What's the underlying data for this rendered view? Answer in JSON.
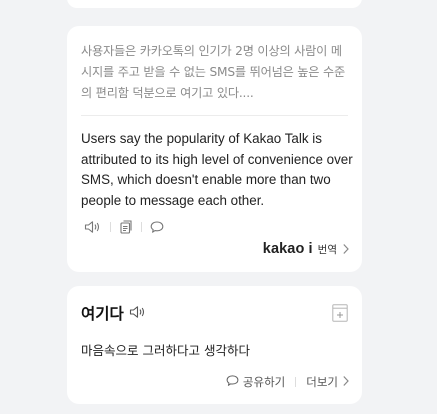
{
  "translation": {
    "source_text": "사용자들은 카카오톡의 인기가 2명 이상의 사람이 메시지를 주고 받을 수 없는 SMS를 뛰어넘은 높은 수준의 편리함 덕분으로 여기고 있다....",
    "target_text": "Users say the popularity of Kakao Talk is attributed to its high level of convenience over SMS, which doesn't enable more than two people to message each other.",
    "tools": [
      "speaker-icon",
      "copy-icon",
      "comment-icon"
    ],
    "brand": "kakao i",
    "brand_suffix": "번역"
  },
  "dictionary": {
    "word": "여기다",
    "meaning": "마음속으로 그러하다고 생각하다",
    "share_label": "공유하기",
    "more_label": "더보기"
  },
  "colors": {
    "background": "#f2f3f5",
    "card": "#ffffff",
    "source_text": "#8b8b8b",
    "text": "#222222"
  }
}
